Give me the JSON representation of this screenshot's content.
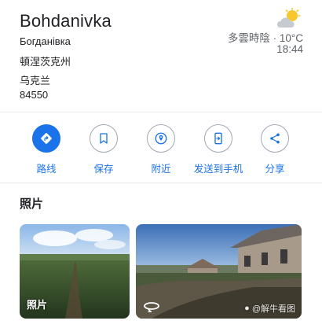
{
  "place": {
    "title": "Bohdanivka",
    "address_lines": [
      "Богданівка",
      "頓涅茨克州",
      "乌克兰",
      "84550"
    ]
  },
  "weather": {
    "condition": "多雲時陰 · 10°C",
    "time": "18:44",
    "icon": "partly-cloudy-icon"
  },
  "actions": [
    {
      "label": "路线",
      "icon": "directions-icon"
    },
    {
      "label": "保存",
      "icon": "bookmark-icon"
    },
    {
      "label": "附近",
      "icon": "nearby-icon"
    },
    {
      "label": "发送到手机",
      "icon": "send-to-phone-icon"
    },
    {
      "label": "分享",
      "icon": "share-icon"
    }
  ],
  "colors": {
    "accent": "#1a73e8",
    "text_primary": "#202124",
    "text_secondary": "#5f6368"
  },
  "photos": {
    "section_title": "照片",
    "items": [
      {
        "label": "照片",
        "type": "photo"
      },
      {
        "label": "",
        "type": "street-view",
        "icon": "360-rotate-icon"
      }
    ]
  },
  "watermark": {
    "text": "@解牛看图"
  }
}
